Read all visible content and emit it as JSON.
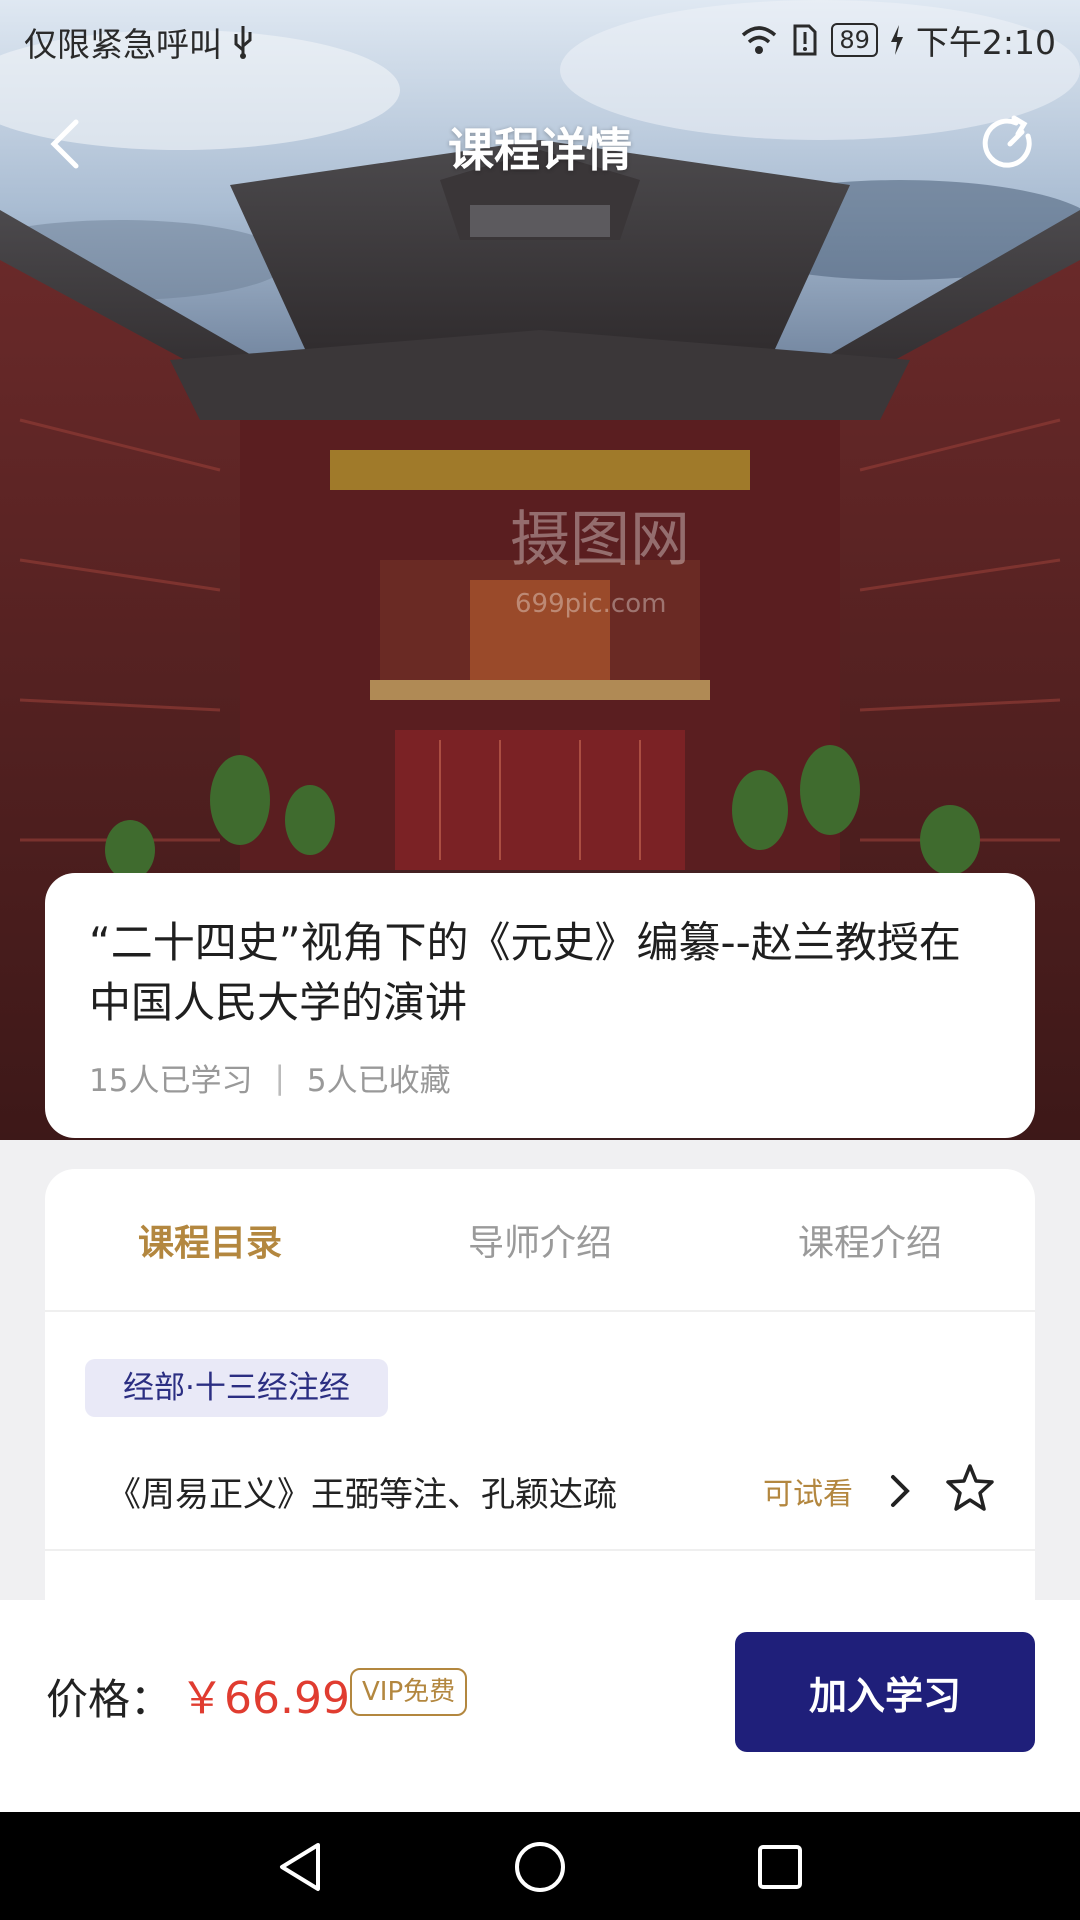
{
  "status_bar": {
    "carrier_text": "仅限紧急呼叫",
    "battery": "89",
    "time": "下午2:10"
  },
  "nav": {
    "title": "课程详情",
    "back_icon": "chevron-left-icon",
    "share_icon": "refresh-share-icon"
  },
  "hero": {
    "watermark_text": "摄图网",
    "watermark_sub": "699pic.com"
  },
  "course": {
    "title": "“二十四史”视角下的《元史》编纂--赵兰教授在中国人民大学的演讲",
    "learners": "15人已学习",
    "separator": "|",
    "favorites": "5人已收藏"
  },
  "tabs": [
    {
      "label": "课程目录",
      "active": true
    },
    {
      "label": "导师介绍",
      "active": false
    },
    {
      "label": "课程介绍",
      "active": false
    }
  ],
  "catalog": {
    "category": "经部·十三经注经",
    "lessons": [
      {
        "title": "《周易正义》王弼等注、孔颖达疏",
        "trial_label": "可试看"
      }
    ]
  },
  "buy_bar": {
    "price_label": "价格：",
    "price_value": "￥66.99",
    "vip_badge": "VIP免费",
    "join_label": "加入学习",
    "accent_color": "#1f1f7a",
    "price_color": "#e03c30",
    "gold_color": "#b3873f"
  }
}
